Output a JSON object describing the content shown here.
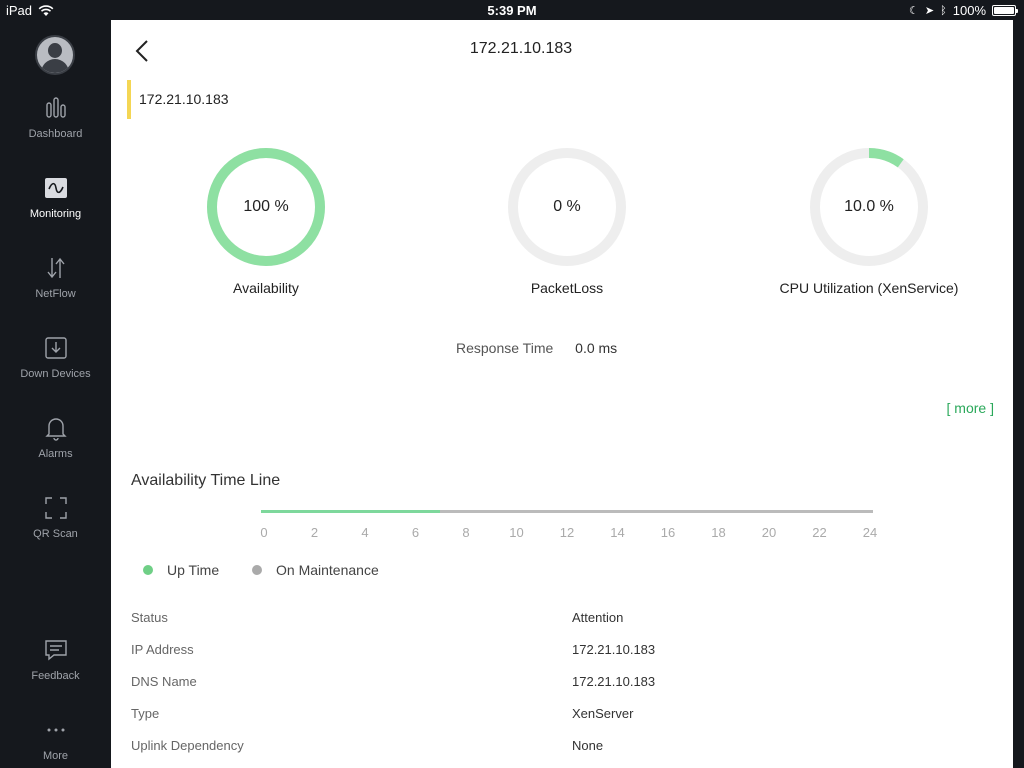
{
  "statusbar": {
    "device": "iPad",
    "time": "5:39 PM",
    "battery": "100%"
  },
  "sidebar": {
    "items": [
      {
        "label": "Dashboard",
        "icon": "bar-chart-icon",
        "active": false
      },
      {
        "label": "Monitoring",
        "icon": "wave-monitor-icon",
        "active": true
      },
      {
        "label": "NetFlow",
        "icon": "updown-arrows-icon",
        "active": false
      },
      {
        "label": "Down Devices",
        "icon": "download-box-icon",
        "active": false
      },
      {
        "label": "Alarms",
        "icon": "bell-icon",
        "active": false
      },
      {
        "label": "QR Scan",
        "icon": "scan-frame-icon",
        "active": false
      },
      {
        "label": "Feedback",
        "icon": "message-icon",
        "active": false
      },
      {
        "label": "More",
        "icon": "ellipsis-icon",
        "active": false
      }
    ]
  },
  "header": {
    "title": "172.21.10.183"
  },
  "subheader": {
    "label": "172.21.10.183"
  },
  "gauges": [
    {
      "label": "Availability",
      "value_text": "100 %",
      "percent": 100,
      "color": "#8ee0a2"
    },
    {
      "label": "PacketLoss",
      "value_text": "0 %",
      "percent": 0,
      "color": "#8ee0a2"
    },
    {
      "label": "CPU Utilization (XenService)",
      "value_text": "10.0 %",
      "percent": 10,
      "color": "#8ee0a2"
    }
  ],
  "response": {
    "label": "Response Time",
    "value": "0.0 ms"
  },
  "more_link": "[ more ]",
  "timeline": {
    "title": "Availability Time Line",
    "ticks": [
      "0",
      "2",
      "4",
      "6",
      "8",
      "10",
      "12",
      "14",
      "16",
      "18",
      "20",
      "22",
      "24"
    ],
    "uptime_hours": 7,
    "max_hours": 24
  },
  "legend": [
    {
      "label": "Up Time",
      "color": "#6fcf86"
    },
    {
      "label": "On Maintenance",
      "color": "#aaaaaa"
    }
  ],
  "details": [
    {
      "key": "Status",
      "value": "Attention"
    },
    {
      "key": "IP Address",
      "value": "172.21.10.183"
    },
    {
      "key": "DNS Name",
      "value": "172.21.10.183"
    },
    {
      "key": "Type",
      "value": "XenServer"
    },
    {
      "key": "Uplink Dependency",
      "value": "None"
    }
  ],
  "colors": {
    "accent_green": "#2aa85a",
    "subheader_bar": "#f4d654",
    "sidebar_bg": "#15181d"
  }
}
